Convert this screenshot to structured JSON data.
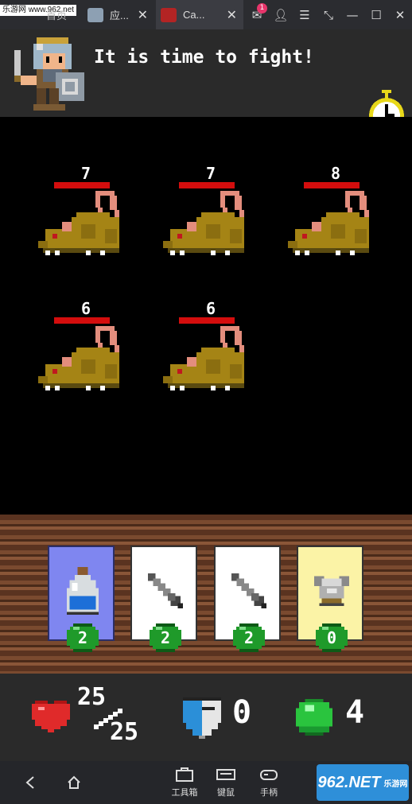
{
  "topbar": {
    "watermark": "乐游网 www.962.net",
    "tabs": [
      {
        "label": "首页"
      },
      {
        "label": "应..."
      },
      {
        "label": "Ca..."
      }
    ],
    "notification_count": "1"
  },
  "header": {
    "message": "It is time to fight!"
  },
  "enemies": [
    {
      "hp": "7",
      "icon": "rat"
    },
    {
      "hp": "7",
      "icon": "rat"
    },
    {
      "hp": "8",
      "icon": "rat"
    },
    {
      "hp": "6",
      "icon": "rat"
    },
    {
      "hp": "6",
      "icon": "rat"
    }
  ],
  "cards": [
    {
      "type": "potion",
      "cost": "2"
    },
    {
      "type": "sword",
      "cost": "2"
    },
    {
      "type": "sword",
      "cost": "2"
    },
    {
      "type": "armor",
      "cost": "0"
    }
  ],
  "stats": {
    "hp_current": "25",
    "hp_max": "25",
    "armor": "0",
    "gems": "4"
  },
  "bottomnav": {
    "items": [
      {
        "label": "工具箱"
      },
      {
        "label": "键鼠"
      },
      {
        "label": "手柄"
      }
    ],
    "brand": "962.NET",
    "brand_sub": "乐游网"
  },
  "colors": {
    "hp_bar": "#d40d0d",
    "potion_card": "#7f86f0",
    "armor_card": "#fbf3a6",
    "cost_badge": "#1f9a2a"
  }
}
